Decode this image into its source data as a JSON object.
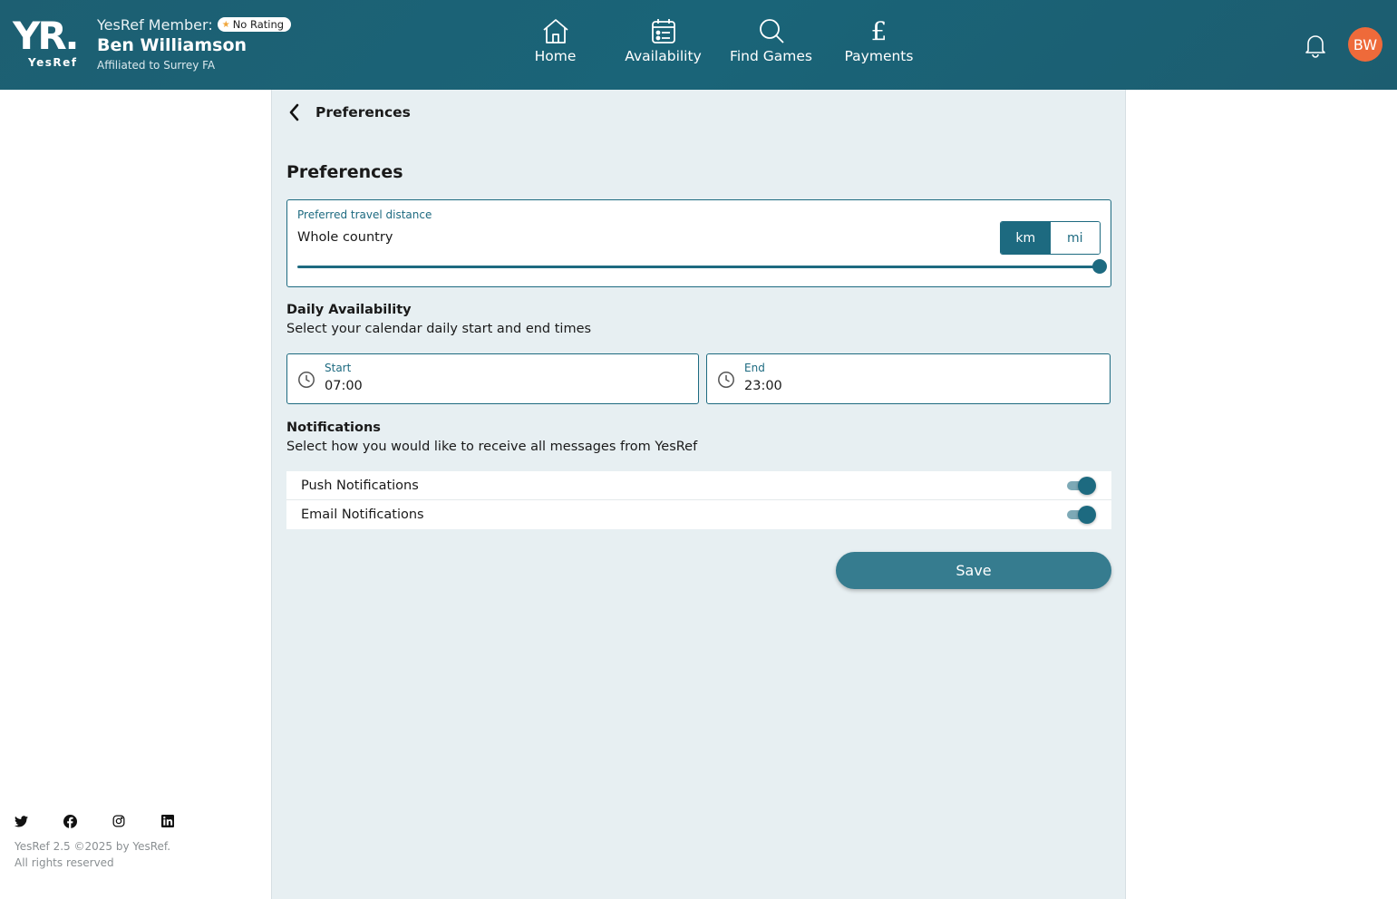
{
  "header": {
    "logo_mark": "YR.",
    "logo_text": "YesRef",
    "member_label": "YesRef Member:",
    "rating_badge": "No Rating",
    "member_name": "Ben Williamson",
    "affiliation": "Affiliated to Surrey FA",
    "nav": [
      {
        "label": "Home",
        "icon": "home-icon"
      },
      {
        "label": "Availability",
        "icon": "calendar-icon"
      },
      {
        "label": "Find Games",
        "icon": "search-icon"
      },
      {
        "label": "Payments",
        "icon": "pound-icon"
      }
    ],
    "avatar_initials": "BW",
    "colors": {
      "header_bg": "#1d5f72",
      "avatar_bg": "#ee6a3a",
      "star": "#f0a63c"
    }
  },
  "page": {
    "back_title": "Preferences",
    "title": "Preferences"
  },
  "distance": {
    "label": "Preferred travel distance",
    "value": "Whole country",
    "units": [
      "km",
      "mi"
    ],
    "selected_unit": "km",
    "slider_level": 1.0
  },
  "availability": {
    "title": "Daily Availability",
    "description": "Select your calendar daily start and end times",
    "start_label": "Start",
    "start_value": "07:00",
    "end_label": "End",
    "end_value": "23:00"
  },
  "notifications": {
    "title": "Notifications",
    "description": "Select how you would like to receive all messages from YesRef",
    "items": [
      {
        "label": "Push Notifications",
        "enabled": true
      },
      {
        "label": "Email Notifications",
        "enabled": true
      }
    ]
  },
  "save_label": "Save",
  "footer": {
    "social": [
      "twitter-icon",
      "facebook-icon",
      "instagram-icon",
      "linkedin-icon"
    ],
    "version_line": "YesRef 2.5 ©2025 by YesRef.",
    "rights_line": "All rights reserved"
  },
  "accent_color": "#1d6a80"
}
